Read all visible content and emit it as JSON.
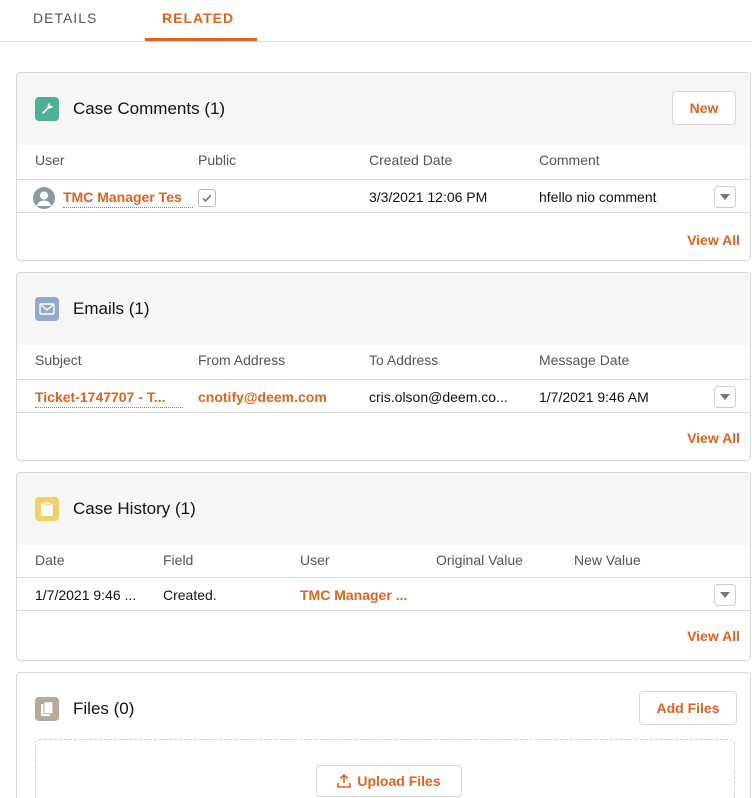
{
  "tabs": {
    "details": "DETAILS",
    "related": "RELATED"
  },
  "case_comments": {
    "title": "Case Comments (1)",
    "new_button": "New",
    "columns": [
      "User",
      "Public",
      "Created Date",
      "Comment"
    ],
    "row": {
      "user": "TMC Manager Tes",
      "created": "3/3/2021 12:06 PM",
      "comment": "hfello nio comment"
    },
    "view_all": "View All",
    "icon": "wrench-icon",
    "icon_color": "#4bb198"
  },
  "emails": {
    "title": "Emails (1)",
    "columns": [
      "Subject",
      "From Address",
      "To Address",
      "Message Date"
    ],
    "row": {
      "subject": "Ticket-1747707 - T...",
      "from": "cnotify@deem.com",
      "to": "cris.olson@deem.co...",
      "date": "1/7/2021 9:46 AM"
    },
    "view_all": "View All",
    "icon": "envelope-icon",
    "icon_color": "#94a8c7"
  },
  "case_history": {
    "title": "Case History (1)",
    "columns": [
      "Date",
      "Field",
      "User",
      "Original Value",
      "New Value"
    ],
    "row": {
      "date": "1/7/2021 9:46 ...",
      "field": "Created.",
      "user": "TMC Manager ..."
    },
    "view_all": "View All",
    "icon": "clipboard-icon",
    "icon_color": "#f2d067"
  },
  "files": {
    "title": "Files (0)",
    "add_button": "Add Files",
    "upload_button": "Upload Files",
    "icon": "files-icon",
    "icon_color": "#b9a99a"
  },
  "colors": {
    "accent": "#e0621c",
    "header_bg": "#f6f6f6"
  }
}
